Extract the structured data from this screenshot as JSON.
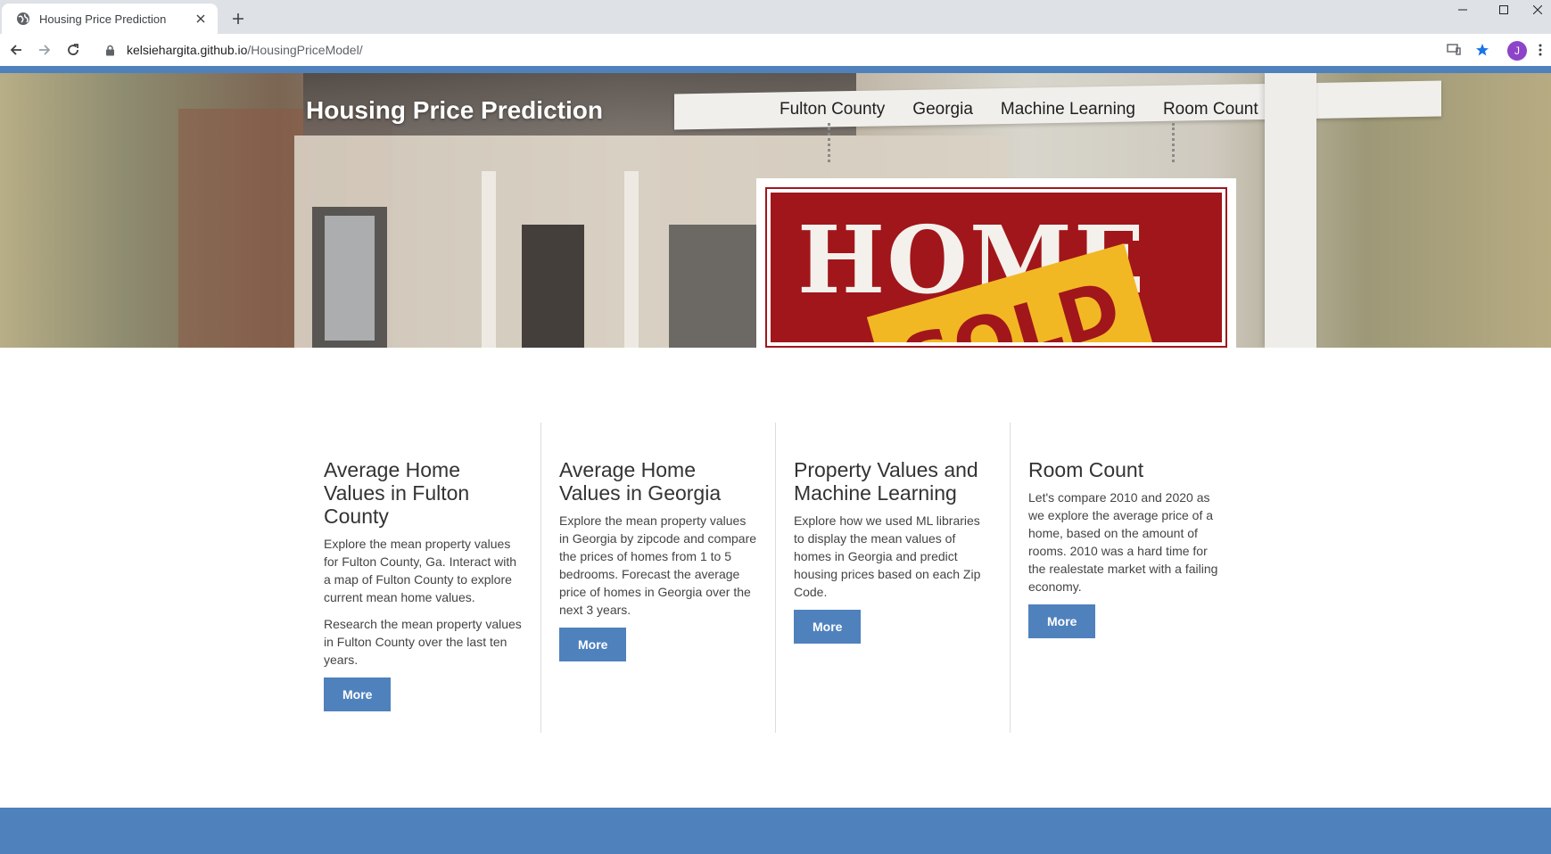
{
  "browser": {
    "tab_title": "Housing Price Prediction",
    "url_host": "kelsiehargita.github.io",
    "url_path": "/HousingPriceModel/",
    "profile_initial": "J"
  },
  "site": {
    "title": "Housing Price Prediction",
    "nav": [
      "Fulton County",
      "Georgia",
      "Machine Learning",
      "Room Count"
    ],
    "hero_sign_text": "HOME",
    "hero_sign_overlay": "SOLD"
  },
  "cards": [
    {
      "heading": "Average Home Values in Fulton County",
      "paragraphs": [
        "Explore the mean property values for Fulton County, Ga. Interact with a map of Fulton County to explore current mean home values.",
        "Research the mean property values in Fulton County over the last ten years."
      ],
      "button": "More"
    },
    {
      "heading": "Average Home Values in Georgia",
      "paragraphs": [
        "Explore the mean property values in Georgia by zipcode and compare the prices of homes from 1 to 5 bedrooms. Forecast the average price of homes in Georgia over the next 3 years."
      ],
      "button": "More"
    },
    {
      "heading": "Property Values and Machine Learning",
      "paragraphs": [
        "Explore how we used ML libraries to display the mean values of homes in Georgia and predict housing prices based on each Zip Code."
      ],
      "button": "More"
    },
    {
      "heading": "Room Count",
      "paragraphs": [
        "Let's compare 2010 and 2020 as we explore the average price of a home, based on the amount of rooms. 2010 was a hard time for the realestate market with a failing economy."
      ],
      "button": "More"
    }
  ],
  "colors": {
    "accent": "#4f81bd",
    "sign_red": "#a1161b",
    "sign_yellow": "#f2b824"
  }
}
